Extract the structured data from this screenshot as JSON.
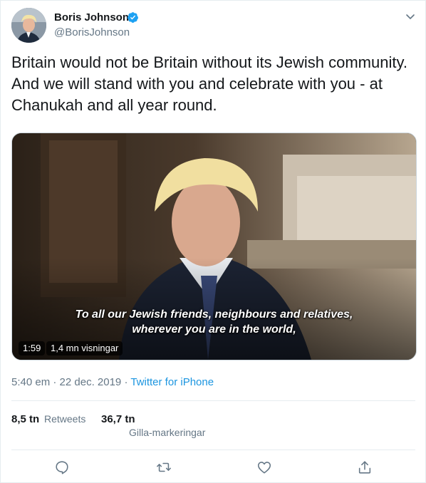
{
  "tweet": {
    "author_name": "Boris Johnson",
    "author_handle": "@BorisJohnson",
    "text": "Britain would not be Britain without its Jewish community. And we will stand with you and celebrate with you - at Chanukah and all year round.",
    "video": {
      "subtitle_line1": "To all our Jewish friends, neighbours and relatives,",
      "subtitle_line2": "wherever you are in the world,",
      "duration": "1:59",
      "views": "1,4 mn visningar"
    },
    "timestamp": "5:40 em · 22 dec. 2019 · ",
    "source": "Twitter for iPhone",
    "retweets_count": "8,5 tn",
    "retweets_label": "Retweets",
    "likes_count": "36,7 tn",
    "likes_label": "Gilla-markeringar"
  },
  "icons": {
    "verified": "verified-badge-icon",
    "menu": "chevron-down-icon",
    "reply": "reply-icon",
    "retweet": "retweet-icon",
    "like": "heart-icon",
    "share": "share-icon"
  },
  "colors": {
    "accent": "#1da1f2",
    "link": "#1b95e0",
    "secondary_text": "#657786",
    "primary_text": "#14171a",
    "border": "#e6ecf0"
  }
}
